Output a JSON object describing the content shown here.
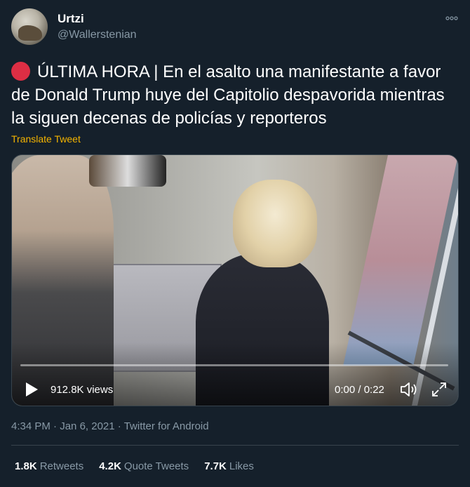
{
  "author": {
    "display_name": "Urtzi",
    "handle": "@Wallerstenian",
    "avatar_icon": "avatar-photo"
  },
  "tweet": {
    "emoji_icon": "red-circle-icon",
    "text": "ÚLTIMA HORA | En el asalto una manifestante a favor de Donald Trump huye del Capitolio despavorida mientras la siguen decenas de policías y reporteros",
    "translate_label": "Translate Tweet"
  },
  "video": {
    "views": "912.8K views",
    "timer": "0:00 / 0:22",
    "progress": 0,
    "icons": [
      "play-icon",
      "volume-icon",
      "fullscreen-icon"
    ]
  },
  "meta": {
    "time": "4:34 PM",
    "separator1": "·",
    "date": "Jan 6, 2021",
    "separator2": "·",
    "source": "Twitter for Android"
  },
  "stats": {
    "retweets_count": "1.8K",
    "retweets_label": "Retweets",
    "quote_count": "4.2K",
    "quote_label": "Quote Tweets",
    "likes_count": "7.7K",
    "likes_label": "Likes"
  },
  "colors": {
    "background": "#15202b",
    "text": "#ffffff",
    "secondary": "#8899a6",
    "translate": "#f4b400",
    "emoji_red": "#dd2e44",
    "divider": "#38444d"
  }
}
